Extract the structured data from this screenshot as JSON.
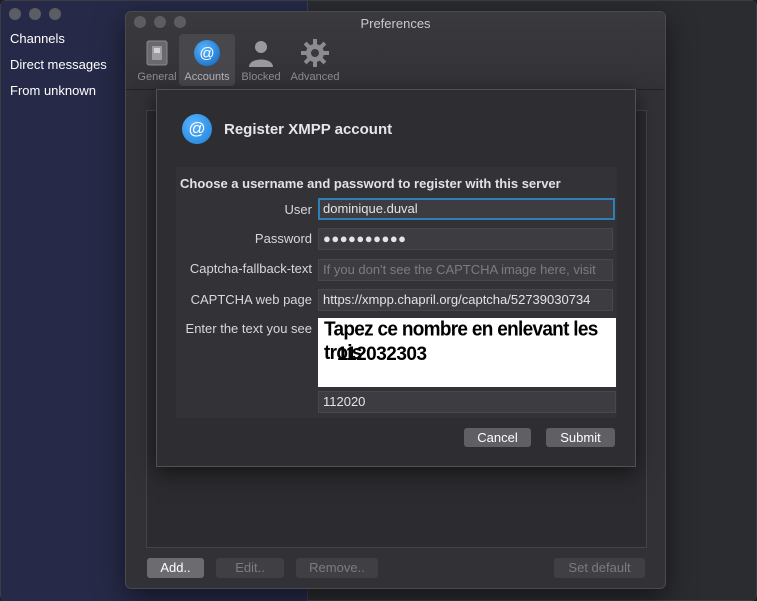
{
  "sidebar": {
    "items": [
      {
        "label": "Channels"
      },
      {
        "label": "Direct messages"
      },
      {
        "label": "From unknown"
      }
    ]
  },
  "preferences": {
    "title": "Preferences",
    "toolbar": [
      {
        "label": "General",
        "icon": "switch-icon"
      },
      {
        "label": "Accounts",
        "icon": "at-sign-icon",
        "selected": true
      },
      {
        "label": "Blocked",
        "icon": "person-icon"
      },
      {
        "label": "Advanced",
        "icon": "gear-icon"
      }
    ],
    "buttons": {
      "add": "Add..",
      "edit": "Edit..",
      "remove": "Remove..",
      "set_default": "Set default"
    }
  },
  "register": {
    "title": "Register XMPP account",
    "heading": "Choose a username and password to register with this server",
    "user_label": "User",
    "user_value": "dominique.duval",
    "password_label": "Password",
    "password_value": "●●●●●●●●●●",
    "captcha_fallback_label": "Captcha-fallback-text",
    "captcha_fallback_placeholder": "If you don't see the CAPTCHA image here, visit",
    "captcha_page_label": "CAPTCHA web page",
    "captcha_page_value": "https://xmpp.chapril.org/captcha/52739030734",
    "captcha_text_label": "Enter the text you see",
    "captcha_image_line1": "Tapez ce nombre en enlevant les trois",
    "captcha_image_line2": "112032303",
    "captcha_answer": "112020",
    "cancel": "Cancel",
    "submit": "Submit"
  },
  "colors": {
    "sidebar_bg": "#262a48",
    "accent": "#2e7fb8",
    "window_bg": "#323236"
  }
}
